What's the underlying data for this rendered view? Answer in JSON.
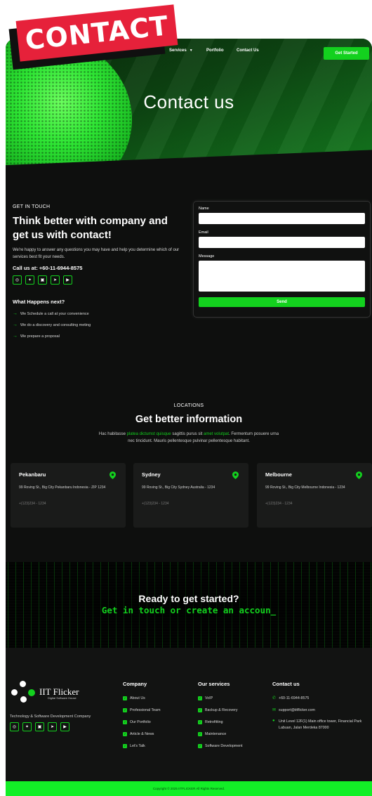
{
  "tag": {
    "label": "CONTACT"
  },
  "nav": {
    "items": [
      {
        "label": "Services",
        "has_dropdown": true
      },
      {
        "label": "Portfolio"
      },
      {
        "label": "Contact Us"
      }
    ],
    "cta_label": "Get Started"
  },
  "hero": {
    "title": "Contact us"
  },
  "get_in_touch": {
    "eyebrow": "GET IN TOUCH",
    "heading": "Think better with company and get us with contact!",
    "description": "We're happy to answer any questions you may have and help you determine which of our services best fit your needs.",
    "call_us": "Call us at: +60-11-6944-8575",
    "socials": [
      "instagram-icon",
      "twitter-icon",
      "linkedin-icon",
      "telegram-icon",
      "youtube-icon"
    ],
    "next_heading": "What Happens next?",
    "steps": [
      "We Schedule a call at your convenience",
      "We do a discovery and consulting meting",
      "We prepare a proposal"
    ]
  },
  "form": {
    "name_label": "Name",
    "email_label": "Email",
    "message_label": "Message",
    "send_label": "Send"
  },
  "locations": {
    "eyebrow": "LOCATIONS",
    "title": "Get better information",
    "desc_1": "Hac habitasse ",
    "desc_hl_1": "platea dictumst quisque",
    "desc_2": " sagittis purus sit ",
    "desc_hl_2": "amet volutpat",
    "desc_3": ". Fermentum posuere urna nec tincidunt. Mauris pellentesque pulvinar pellentesque habitant.",
    "cards": [
      {
        "city": "Pekanbaru",
        "address": "99 Roving St., Big City Pekanbaru Indonesia - ZIP 1234",
        "phone": "+(123)234 - 1234"
      },
      {
        "city": "Sydney",
        "address": "99 Roving St., Big City Sydney Australia - 1234",
        "phone": "+(123)234 - 1234"
      },
      {
        "city": "Melbourne",
        "address": "99 Roving St., Big City Melbourne Indonesia - 1234",
        "phone": "+(123)234 - 1234"
      }
    ]
  },
  "cta": {
    "line1": "Ready to get started?",
    "line2": "Get in touch or create an accoun_"
  },
  "footer": {
    "logo_name": "IIT Flicker",
    "logo_sub": "Digital Software House",
    "tagline": "Technology & Software Development Company",
    "company_heading": "Company",
    "company_items": [
      "About Us",
      "Professional Team",
      "Our Portfolio",
      "Article & News",
      "Let's Talk"
    ],
    "services_heading": "Our services",
    "services_items": [
      "VoIP",
      "Backup & Recovery",
      "Retrofitting",
      "Maintenance",
      "Software Development"
    ],
    "contact_heading": "Contact us",
    "phone": "+60-11-6944-8575",
    "email": "support@iitflicker.com",
    "address": "Unit Level 12F(1) Main office tower, Financial Park Labuan, Jalan Merdeka 87000",
    "copyright": "Copyright © 2025 IITFLICKER All Rights Reserved."
  },
  "colors": {
    "accent": "#13d11e",
    "tag": "#e6213a",
    "background": "#0e0f0e"
  }
}
